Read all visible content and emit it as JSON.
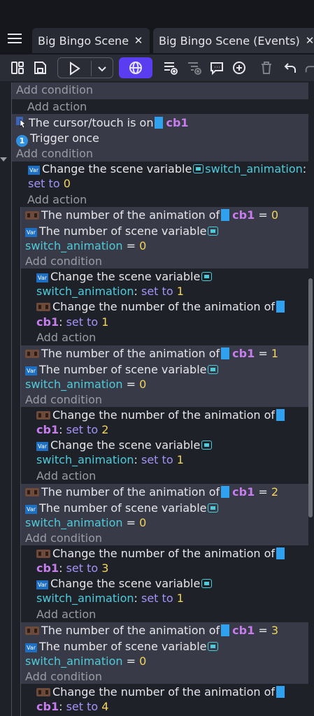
{
  "tabs": [
    {
      "label": "Big Bingo Scene",
      "close": "✕"
    },
    {
      "label": "Big Bingo Scene (Events)",
      "close": "✕"
    }
  ],
  "toolbar": {
    "icons": [
      "panels-icon",
      "save-icon",
      "play-icon",
      "chevron-down-icon",
      "globe-icon",
      "add-event-icon",
      "add-subevent-icon",
      "add-comment-icon",
      "add-plus-icon",
      "trash-icon",
      "undo-icon",
      "redo-icon"
    ],
    "accent": "#5b3df1"
  },
  "events": {
    "add_condition": "Add condition",
    "add_action": "Add action",
    "cursor_on": "The cursor/touch is on",
    "trigger_once": "Trigger once",
    "change_scene_var": "Change the scene variable",
    "set_to": "set to",
    "anim_number_of": "The number of the animation of",
    "scene_var_number": "The number of scene variable",
    "change_anim_number": "Change the number of the animation of",
    "object": "cb1",
    "variable": "switch_animation",
    "eq": "= ",
    "one_badge": "1",
    "var_badge": "Var",
    "colon": ":",
    "vals": [
      "0",
      "1",
      "2",
      "3",
      "4"
    ]
  }
}
